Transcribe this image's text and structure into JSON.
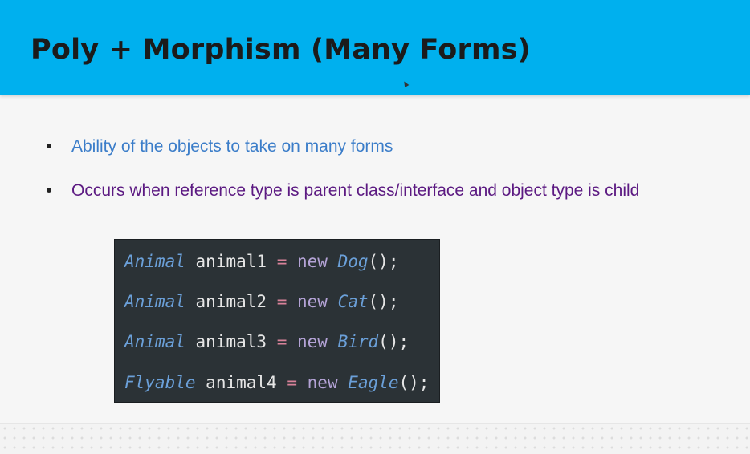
{
  "slide": {
    "title": "Poly + Morphism (Many Forms)",
    "bullets": [
      "Ability of the objects to take on many forms",
      "Occurs when reference type is parent class/interface and object type is child"
    ],
    "code": [
      {
        "type": "Animal",
        "var": "animal1",
        "eq": "=",
        "kw": "new",
        "cls": "Dog",
        "end": "();"
      },
      {
        "type": "Animal",
        "var": "animal2",
        "eq": "=",
        "kw": "new",
        "cls": "Cat",
        "end": "();"
      },
      {
        "type": "Animal",
        "var": "animal3",
        "eq": "=",
        "kw": "new",
        "cls": "Bird",
        "end": "();"
      },
      {
        "type": "Flyable",
        "var": "animal4",
        "eq": "=",
        "kw": "new",
        "cls": "Eagle",
        "end": "();"
      }
    ]
  },
  "colors": {
    "header_bg": "#00b0ee",
    "bullet_1": "#3b7dc9",
    "bullet_2": "#5c1a82",
    "code_bg": "#2b3236"
  }
}
